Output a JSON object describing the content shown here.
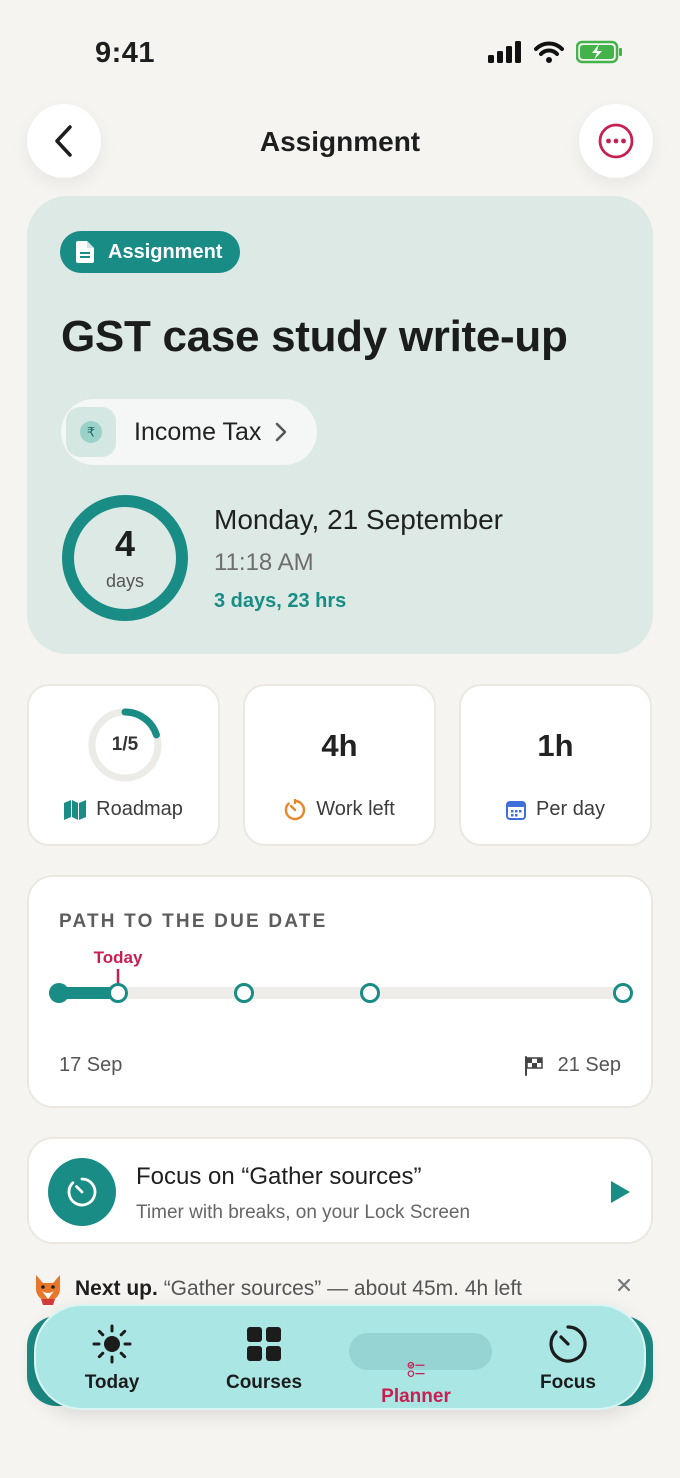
{
  "status_bar": {
    "time": "9:41"
  },
  "nav": {
    "title": "Assignment"
  },
  "hero": {
    "type_label": "Assignment",
    "title": "GST case study write-up",
    "course": "Income Tax",
    "course_icon": "rupee-icon",
    "days_left": "4",
    "days_unit": "days",
    "due_date": "Monday, 21 September",
    "due_time": "11:18 AM",
    "time_remaining": "3 days, 23 hrs"
  },
  "stats": {
    "roadmap": {
      "progress": "1/5",
      "completed": 1,
      "total": 5,
      "label": "Roadmap"
    },
    "work_left": {
      "value": "4h",
      "label": "Work left"
    },
    "per_day": {
      "value": "1h",
      "label": "Per day"
    }
  },
  "path": {
    "title": "PATH TO THE DUE DATE",
    "today_label": "Today",
    "start_date": "17 Sep",
    "end_date": "21 Sep"
  },
  "focus": {
    "title": "Focus on “Gather sources”",
    "subtitle": "Timer with breaks, on your Lock Screen"
  },
  "next_up": {
    "label": "Next up.",
    "text": "“Gather sources” — about 45m. 4h left"
  },
  "tabs": [
    {
      "label": "Today",
      "icon": "sun-icon",
      "active": false
    },
    {
      "label": "Courses",
      "icon": "grid-icon",
      "active": false
    },
    {
      "label": "Planner",
      "icon": "checklist-icon",
      "active": true
    },
    {
      "label": "Focus",
      "icon": "timer-icon",
      "active": false
    }
  ],
  "colors": {
    "accent": "#1a8c86",
    "highlight": "#c81f52",
    "hero_bg": "#dde9e5",
    "tabbar_bg": "#a9e6e4"
  }
}
